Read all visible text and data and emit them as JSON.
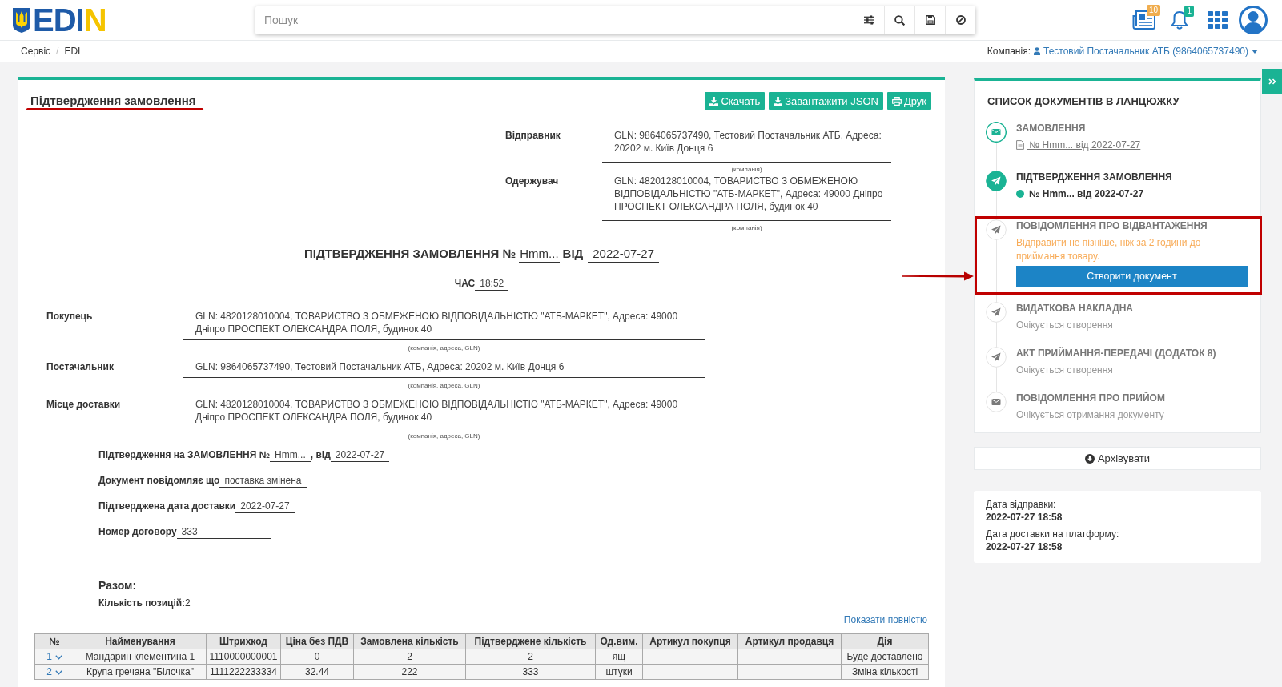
{
  "header": {
    "logo": "EDIN",
    "search": {
      "placeholder": "Пошук"
    },
    "notifications": [
      {
        "kind": "news",
        "count": "10",
        "color": "#f0ad4e"
      },
      {
        "kind": "alerts",
        "count": "1",
        "color": "#1ab394"
      }
    ]
  },
  "breadcrumbs": {
    "items": [
      "Сервіс",
      "EDI"
    ],
    "separator": "/"
  },
  "company": {
    "label": "Компанія:",
    "name": "Тестовий Постачальник АТБ (9864065737490)"
  },
  "document": {
    "title": "Підтвердження замовлення",
    "title_underlined": true,
    "buttons": [
      {
        "kind": "download",
        "label": "Скачать"
      },
      {
        "kind": "json",
        "label": "Завантажити JSON"
      },
      {
        "kind": "print",
        "label": "Друк"
      }
    ],
    "parties_top": [
      {
        "label": "Відправник",
        "value": "GLN: 9864065737490, Тестовий Постачальник АТБ, Адреса: 20202 м. Київ Донця 6",
        "caption": "(компанія)"
      },
      {
        "label": "Одержувач",
        "value": "GLN: 4820128010004, ТОВАРИСТВО З ОБМЕЖЕНОЮ ВІДПОВІДАЛЬНІСТЮ \"АТБ-МАРКЕТ\", Адреса: 49000 Дніпро ПРОСПЕКТ ОЛЕКСАНДРА ПОЛЯ, будинок 40",
        "caption": "(компанія)"
      }
    ],
    "heading": {
      "title": "ПІДТВЕРДЖЕННЯ ЗАМОВЛЕННЯ №",
      "number": "Hmm...",
      "date_label": "ВІД",
      "date": "2022-07-27"
    },
    "time": {
      "label": "ЧАС",
      "value": "18:52"
    },
    "parties": [
      {
        "label": "Покупець",
        "value": "GLN: 4820128010004, ТОВАРИСТВО З ОБМЕЖЕНОЮ ВІДПОВІДАЛЬНІСТЮ \"АТБ-МАРКЕТ\", Адреса: 49000 Дніпро ПРОСПЕКТ ОЛЕКСАНДРА ПОЛЯ, будинок 40",
        "caption": "(компанія, адреса, GLN)"
      },
      {
        "label": "Постачальник",
        "value": "GLN: 9864065737490, Тестовий Постачальник АТБ, Адреса: 20202 м. Київ Донця 6",
        "caption": "(компанія, адреса, GLN)"
      },
      {
        "label": "Місце доставки",
        "value": "GLN: 4820128010004, ТОВАРИСТВО З ОБМЕЖЕНОЮ ВІДПОВІДАЛЬНІСТЮ \"АТБ-МАРКЕТ\", Адреса: 49000 Дніпро ПРОСПЕКТ ОЛЕКСАНДРА ПОЛЯ, будинок 40",
        "caption": "(компанія, адреса, GLN)"
      }
    ],
    "details": [
      [
        {
          "kind": "label",
          "text": "Підтвердження на ЗАМОВЛЕННЯ №"
        },
        {
          "kind": "field",
          "text": "Hmm..."
        },
        {
          "kind": "label",
          "text": ", від"
        },
        {
          "kind": "field",
          "text": "2022-07-27"
        }
      ],
      [
        {
          "kind": "label",
          "text": "Документ повідомляє що"
        },
        {
          "kind": "field",
          "text": "поставка змінена"
        }
      ],
      [
        {
          "kind": "label",
          "text": "Підтверджена дата доставки"
        },
        {
          "kind": "field",
          "text": "2022-07-27"
        }
      ],
      [
        {
          "kind": "label",
          "text": "Номер договору"
        },
        {
          "kind": "long_field",
          "text": "333"
        }
      ]
    ],
    "totals": {
      "title": "Разом:",
      "count": "**Кількість позицій:**2"
    },
    "show_all": "Показати повністю",
    "table": {
      "columns": [
        "№",
        "Найменування",
        "Штрихкод",
        "Ціна без ПДВ",
        "Замовлена кількість",
        "Підтверджене кількість",
        "Од.вим.",
        "Артикул покупця",
        "Артикул продавця",
        "Дія"
      ],
      "rows": [
        {
          "number": "1",
          "expanded": false,
          "name": "Мандарин клементина 1",
          "barcode": "1110000000001",
          "price": "0",
          "ordered": "2",
          "confirmed": "2",
          "unit": "ящ",
          "action": "Буде доставлено"
        },
        {
          "number": "2",
          "expanded": false,
          "name": "Крупа гречана \"Білочка\"",
          "barcode": "1111222233334",
          "price": "32.44",
          "ordered": "222",
          "confirmed": "333",
          "unit": "штуки",
          "action": "Зміна кількості"
        }
      ]
    }
  },
  "chain": {
    "title": "СПИСОК ДОКУМЕНТІВ В ЛАНЦЮЖКУ",
    "items": [
      {
        "kind": "incoming",
        "completed": true,
        "selected": false,
        "title": "ЗАМОВЛЕННЯ",
        "subtitle": " № Hmm... від 2022-07-27",
        "highlighted": false
      },
      {
        "kind": "outgoing",
        "completed": true,
        "selected": true,
        "title": "ПІДТВЕРДЖЕННЯ ЗАМОВЛЕННЯ",
        "subtitle": "№ Hmm... від 2022-07-27",
        "highlighted": false
      },
      {
        "kind": "outgoing",
        "completed": false,
        "selected": false,
        "title": "ПОВІДОМЛЕННЯ ПРО ВІДВАНТАЖЕННЯ",
        "note": "Відправити не пізніше, ніж за 2 години до приймання товару.",
        "action": "Створити документ",
        "highlighted": true
      },
      {
        "kind": "outgoing",
        "completed": false,
        "selected": false,
        "title": "ВИДАТКОВА НАКЛАДНА",
        "subtitle": "Очікується створення",
        "highlighted": false
      },
      {
        "kind": "outgoing",
        "completed": false,
        "selected": false,
        "title": "АКТ ПРИЙМАННЯ-ПЕРЕДАЧІ (ДОДАТОК 8)",
        "subtitle": "Очікується створення",
        "highlighted": false
      },
      {
        "kind": "incoming",
        "completed": false,
        "selected": false,
        "title": "ПОВІДОМЛЕННЯ ПРО ПРИЙОМ",
        "subtitle": "Очікується отримання документу",
        "highlighted": false
      }
    ]
  },
  "archive_button": "Архівувати",
  "dates": [
    {
      "label": "Дата відправки:",
      "value": "2022-07-27 18:58"
    },
    {
      "label": "Дата доставки на платформу:",
      "value": "2022-07-27 18:58"
    }
  ]
}
